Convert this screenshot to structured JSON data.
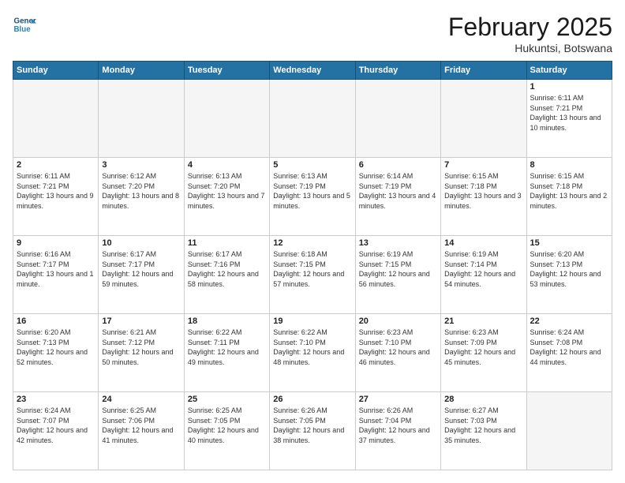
{
  "header": {
    "logo_line1": "General",
    "logo_line2": "Blue",
    "month_year": "February 2025",
    "location": "Hukuntsi, Botswana"
  },
  "days_of_week": [
    "Sunday",
    "Monday",
    "Tuesday",
    "Wednesday",
    "Thursday",
    "Friday",
    "Saturday"
  ],
  "weeks": [
    [
      {
        "day": "",
        "empty": true
      },
      {
        "day": "",
        "empty": true
      },
      {
        "day": "",
        "empty": true
      },
      {
        "day": "",
        "empty": true
      },
      {
        "day": "",
        "empty": true
      },
      {
        "day": "",
        "empty": true
      },
      {
        "day": "1",
        "sunrise": "6:11 AM",
        "sunset": "7:21 PM",
        "daylight": "13 hours and 10 minutes."
      }
    ],
    [
      {
        "day": "2",
        "sunrise": "6:11 AM",
        "sunset": "7:21 PM",
        "daylight": "13 hours and 9 minutes."
      },
      {
        "day": "3",
        "sunrise": "6:12 AM",
        "sunset": "7:20 PM",
        "daylight": "13 hours and 8 minutes."
      },
      {
        "day": "4",
        "sunrise": "6:13 AM",
        "sunset": "7:20 PM",
        "daylight": "13 hours and 7 minutes."
      },
      {
        "day": "5",
        "sunrise": "6:13 AM",
        "sunset": "7:19 PM",
        "daylight": "13 hours and 5 minutes."
      },
      {
        "day": "6",
        "sunrise": "6:14 AM",
        "sunset": "7:19 PM",
        "daylight": "13 hours and 4 minutes."
      },
      {
        "day": "7",
        "sunrise": "6:15 AM",
        "sunset": "7:18 PM",
        "daylight": "13 hours and 3 minutes."
      },
      {
        "day": "8",
        "sunrise": "6:15 AM",
        "sunset": "7:18 PM",
        "daylight": "13 hours and 2 minutes."
      }
    ],
    [
      {
        "day": "9",
        "sunrise": "6:16 AM",
        "sunset": "7:17 PM",
        "daylight": "13 hours and 1 minute."
      },
      {
        "day": "10",
        "sunrise": "6:17 AM",
        "sunset": "7:17 PM",
        "daylight": "12 hours and 59 minutes."
      },
      {
        "day": "11",
        "sunrise": "6:17 AM",
        "sunset": "7:16 PM",
        "daylight": "12 hours and 58 minutes."
      },
      {
        "day": "12",
        "sunrise": "6:18 AM",
        "sunset": "7:15 PM",
        "daylight": "12 hours and 57 minutes."
      },
      {
        "day": "13",
        "sunrise": "6:19 AM",
        "sunset": "7:15 PM",
        "daylight": "12 hours and 56 minutes."
      },
      {
        "day": "14",
        "sunrise": "6:19 AM",
        "sunset": "7:14 PM",
        "daylight": "12 hours and 54 minutes."
      },
      {
        "day": "15",
        "sunrise": "6:20 AM",
        "sunset": "7:13 PM",
        "daylight": "12 hours and 53 minutes."
      }
    ],
    [
      {
        "day": "16",
        "sunrise": "6:20 AM",
        "sunset": "7:13 PM",
        "daylight": "12 hours and 52 minutes."
      },
      {
        "day": "17",
        "sunrise": "6:21 AM",
        "sunset": "7:12 PM",
        "daylight": "12 hours and 50 minutes."
      },
      {
        "day": "18",
        "sunrise": "6:22 AM",
        "sunset": "7:11 PM",
        "daylight": "12 hours and 49 minutes."
      },
      {
        "day": "19",
        "sunrise": "6:22 AM",
        "sunset": "7:10 PM",
        "daylight": "12 hours and 48 minutes."
      },
      {
        "day": "20",
        "sunrise": "6:23 AM",
        "sunset": "7:10 PM",
        "daylight": "12 hours and 46 minutes."
      },
      {
        "day": "21",
        "sunrise": "6:23 AM",
        "sunset": "7:09 PM",
        "daylight": "12 hours and 45 minutes."
      },
      {
        "day": "22",
        "sunrise": "6:24 AM",
        "sunset": "7:08 PM",
        "daylight": "12 hours and 44 minutes."
      }
    ],
    [
      {
        "day": "23",
        "sunrise": "6:24 AM",
        "sunset": "7:07 PM",
        "daylight": "12 hours and 42 minutes."
      },
      {
        "day": "24",
        "sunrise": "6:25 AM",
        "sunset": "7:06 PM",
        "daylight": "12 hours and 41 minutes."
      },
      {
        "day": "25",
        "sunrise": "6:25 AM",
        "sunset": "7:05 PM",
        "daylight": "12 hours and 40 minutes."
      },
      {
        "day": "26",
        "sunrise": "6:26 AM",
        "sunset": "7:05 PM",
        "daylight": "12 hours and 38 minutes."
      },
      {
        "day": "27",
        "sunrise": "6:26 AM",
        "sunset": "7:04 PM",
        "daylight": "12 hours and 37 minutes."
      },
      {
        "day": "28",
        "sunrise": "6:27 AM",
        "sunset": "7:03 PM",
        "daylight": "12 hours and 35 minutes."
      },
      {
        "day": "",
        "empty": true
      }
    ]
  ]
}
